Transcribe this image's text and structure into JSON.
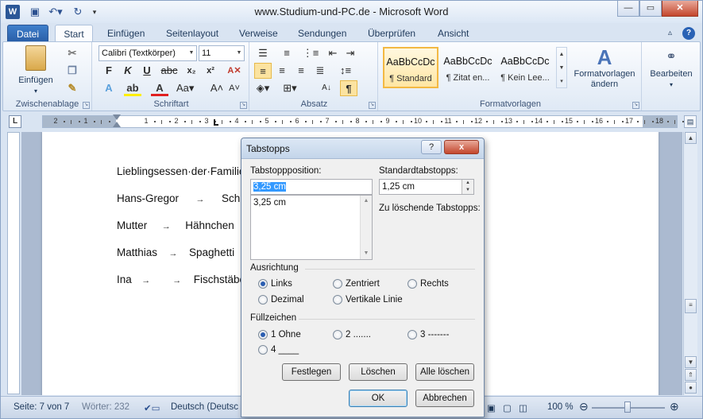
{
  "window": {
    "title": "www.Studium-und-PC.de - Microsoft Word",
    "app_icon": "W"
  },
  "quick_access": {
    "save_icon": "save-icon",
    "undo_icon": "undo-icon",
    "redo_icon": "redo-icon"
  },
  "tabs": [
    {
      "label": "Datei"
    },
    {
      "label": "Start"
    },
    {
      "label": "Einfügen"
    },
    {
      "label": "Seitenlayout"
    },
    {
      "label": "Verweise"
    },
    {
      "label": "Sendungen"
    },
    {
      "label": "Überprüfen"
    },
    {
      "label": "Ansicht"
    }
  ],
  "ribbon": {
    "clipboard": {
      "label": "Zwischenablage",
      "paste": "Einfügen"
    },
    "font": {
      "label": "Schriftart",
      "font_name": "Calibri (Textkörper)",
      "font_size": "11"
    },
    "paragraph": {
      "label": "Absatz"
    },
    "styles": {
      "label": "Formatvorlagen",
      "items": [
        {
          "preview": "AaBbCcDc",
          "name": "¶ Standard"
        },
        {
          "preview": "AaBbCcDc",
          "name": "¶ Zitat en..."
        },
        {
          "preview": "AaBbCcDc",
          "name": "¶ Kein Lee..."
        }
      ],
      "change_line1": "Formatvorlagen",
      "change_line2": "ändern"
    },
    "editing": {
      "label": "Bearbeiten"
    }
  },
  "ruler": {
    "numbers": [
      "2",
      "1",
      "1",
      "2",
      "3",
      "4",
      "5",
      "6",
      "7",
      "8",
      "9",
      "10",
      "11",
      "12",
      "13",
      "14",
      "15",
      "16",
      "17",
      "18"
    ]
  },
  "document": {
    "lines": [
      {
        "text": "Lieblingsessen·der·Familie"
      },
      {
        "a": "Hans-Gregor",
        "b": "Schni"
      },
      {
        "a": "Mutter",
        "b": "Hähnchen"
      },
      {
        "a": "Matthias",
        "b": "Spaghetti"
      },
      {
        "a": "Ina",
        "b": "Fischstäbc"
      }
    ]
  },
  "statusbar": {
    "page": "Seite: 7 von 7",
    "words": "Wörter: 232",
    "language": "Deutsch (Deutsc",
    "zoom": "100 %"
  },
  "dialog": {
    "title": "Tabstopps",
    "help": "?",
    "close": "x",
    "tab_position_label": "Tabstoppposition:",
    "tab_position_value": "3,25 cm",
    "list_items": [
      "3,25 cm"
    ],
    "default_tabs_label": "Standardtabstopps:",
    "default_tabs_value": "1,25 cm",
    "to_clear_label": "Zu löschende Tabstopps:",
    "alignment_label": "Ausrichtung",
    "alignment": {
      "links": "Links",
      "zentriert": "Zentriert",
      "rechts": "Rechts",
      "dezimal": "Dezimal",
      "vertikal": "Vertikale Linie"
    },
    "leader_label": "Füllzeichen",
    "leader": {
      "l1": "1 Ohne",
      "l2": "2 .......",
      "l3": "3 -------",
      "l4": "4 ____"
    },
    "buttons": {
      "set": "Festlegen",
      "clear": "Löschen",
      "clear_all": "Alle löschen",
      "ok": "OK",
      "cancel": "Abbrechen"
    }
  }
}
